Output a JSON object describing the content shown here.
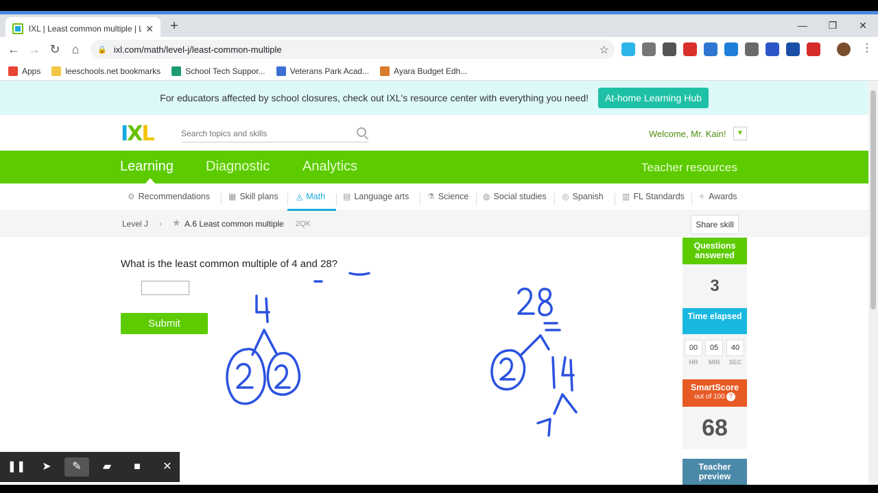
{
  "browser": {
    "tab_title": "IXL | Least common multiple | Le",
    "tab_close": "✕",
    "new_tab": "+",
    "url": "ixl.com/math/level-j/least-common-multiple",
    "bookmarks": [
      {
        "label": "Apps",
        "color": "#e84335"
      },
      {
        "label": "leeschools.net bookmarks",
        "color": "#f4c542"
      },
      {
        "label": "School Tech Suppor...",
        "color": "#1e9c6e"
      },
      {
        "label": "Veterans Park Acad...",
        "color": "#3b6fd4"
      },
      {
        "label": "Ayara Budget Edh...",
        "color": "#d97b2a"
      }
    ],
    "extensions": [
      "#2bb5e8",
      "#777777",
      "#555555",
      "#d9302c",
      "#2e77d0",
      "#1d7fd9",
      "#6a6a6a",
      "#2c56c7",
      "#1a4fa8",
      "#d52b2b"
    ]
  },
  "banner": {
    "text": "For educators affected by school closures, check out IXL's resource center with everything you need!",
    "button": "At-home Learning Hub"
  },
  "header": {
    "logo_i": "I",
    "logo_x": "X",
    "logo_l": "L",
    "search_placeholder": "Search topics and skills",
    "welcome": "Welcome, Mr. Kain!",
    "dropdown": "▼"
  },
  "main_nav": {
    "learning": "Learning",
    "diagnostic": "Diagnostic",
    "analytics": "Analytics",
    "teacher_resources": "Teacher resources"
  },
  "sub_nav": [
    {
      "label": "Recommendations",
      "icon": "⚙"
    },
    {
      "label": "Skill plans",
      "icon": "▦"
    },
    {
      "label": "Math",
      "icon": "◬"
    },
    {
      "label": "Language arts",
      "icon": "▤"
    },
    {
      "label": "Science",
      "icon": "⚗"
    },
    {
      "label": "Social studies",
      "icon": "◍"
    },
    {
      "label": "Spanish",
      "icon": "◎"
    },
    {
      "label": "FL Standards",
      "icon": "▥"
    },
    {
      "label": "Awards",
      "icon": "✧"
    }
  ],
  "breadcrumb": {
    "level": "Level J",
    "arrow": "›",
    "star": "★",
    "skill": "A.6 Least common multiple",
    "code": "2QK",
    "share": "Share skill"
  },
  "question": {
    "text": "What is the least common multiple of 4 and 28?",
    "submit": "Submit"
  },
  "sidebar": {
    "questions_answered_label": "Questions answered",
    "questions_answered": "3",
    "time_elapsed_label": "Time elapsed",
    "hr": "00",
    "min": "05",
    "sec": "40",
    "hr_label": "HR",
    "min_label": "MIN",
    "sec_label": "SEC",
    "smartscore_label": "SmartScore",
    "smartscore_sub": "out of 100",
    "help": "?",
    "smartscore": "68",
    "teacher_preview": "Teacher preview"
  },
  "annotation_toolbar": {
    "pause": "❚❚",
    "pointer": "➤",
    "pen": "✎",
    "highlighter": "▰",
    "camera": "■",
    "close": "✕"
  },
  "window_controls": {
    "minimize": "—",
    "restore": "❐",
    "close": "✕"
  },
  "nav_buttons": {
    "back": "←",
    "forward": "→",
    "reload": "↻",
    "home": "⌂",
    "star": "☆",
    "menu": "⋮",
    "lock": "🔒"
  }
}
